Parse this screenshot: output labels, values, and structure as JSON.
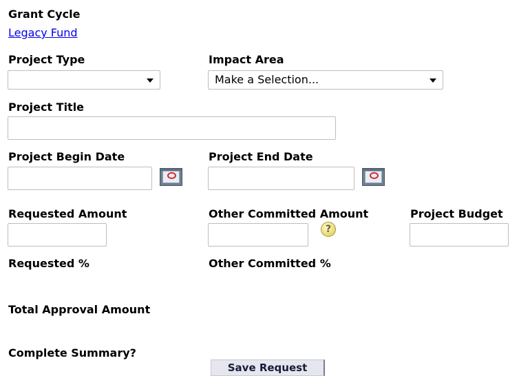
{
  "grant_cycle": {
    "label": "Grant Cycle",
    "link": "Legacy Fund"
  },
  "project_type": {
    "label": "Project Type",
    "value": ""
  },
  "impact_area": {
    "label": "Impact Area",
    "value": "Make a Selection..."
  },
  "project_title": {
    "label": "Project Title",
    "value": ""
  },
  "begin_date": {
    "label": "Project Begin Date",
    "value": ""
  },
  "end_date": {
    "label": "Project End Date",
    "value": ""
  },
  "requested_amount": {
    "label": "Requested Amount",
    "value": ""
  },
  "other_committed_amount": {
    "label": "Other Committed Amount",
    "value": "",
    "help_icon": "?"
  },
  "project_budget": {
    "label": "Project Budget",
    "value": ""
  },
  "requested_pct": {
    "label": "Requested %"
  },
  "other_committed_pct": {
    "label": "Other Committed %"
  },
  "total_approval": {
    "label": "Total Approval Amount"
  },
  "complete_summary": {
    "label": "Complete Summary?"
  },
  "save_button": {
    "label": "Save Request"
  },
  "icons": {
    "calendar": "calendar-icon",
    "help": "help-icon",
    "dropdown": "chevron-down-icon"
  }
}
